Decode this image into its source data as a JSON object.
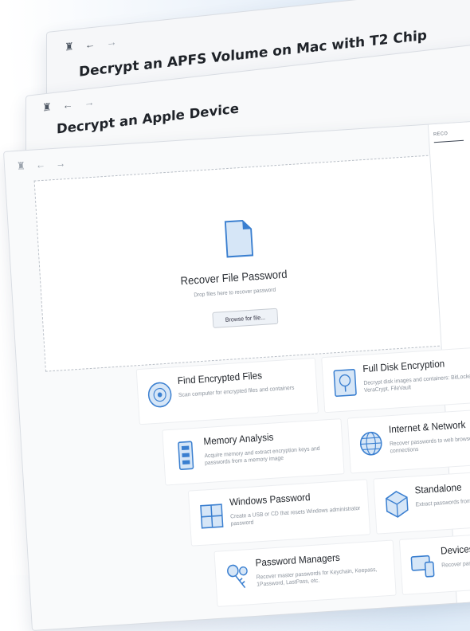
{
  "windows": [
    {
      "title": "Decrypt an APFS Volume on Mac with T2 Chip"
    },
    {
      "title": "Decrypt an Apple Device"
    }
  ],
  "nav": {
    "home_icon": "home-icon",
    "back_icon": "arrow-left-icon",
    "forward_icon": "arrow-right-icon"
  },
  "main": {
    "dropzone": {
      "title": "Recover File Password",
      "subtitle": "Drop files here to recover password",
      "button": "Browse for file..."
    },
    "right_panel_label": "RECO",
    "cards": [
      {
        "title": "Find Encrypted Files",
        "desc": "Scan computer for encrypted files and containers",
        "icon": "disc-icon"
      },
      {
        "title": "Full Disk Encryption",
        "desc": "Decrypt disk images and containers: BitLocker, VeraCrypt, FileVault",
        "icon": "disk-encryption-icon"
      },
      {
        "title": "Memory Analysis",
        "desc": "Acquire memory and extract encryption keys and passwords from a memory image",
        "icon": "memory-chip-icon"
      },
      {
        "title": "Internet & Network",
        "desc": "Recover passwords to web browsers and network connections",
        "icon": "globe-icon"
      },
      {
        "title": "Windows Password",
        "desc": "Create a USB or CD that resets Windows administrator password",
        "icon": "windows-icon"
      },
      {
        "title": "Standalone",
        "desc": "Extract passwords from external drives",
        "icon": "cube-icon"
      },
      {
        "title": "Password Managers",
        "desc": "Recover master passwords for Keychain, Keepass, 1Password, LastPass, etc.",
        "icon": "keys-icon"
      },
      {
        "title": "Devices",
        "desc": "Recover passwords for devices",
        "icon": "devices-icon"
      }
    ]
  },
  "colors": {
    "accent": "#3a7fd0",
    "icon_fill": "#d6e6f7"
  }
}
